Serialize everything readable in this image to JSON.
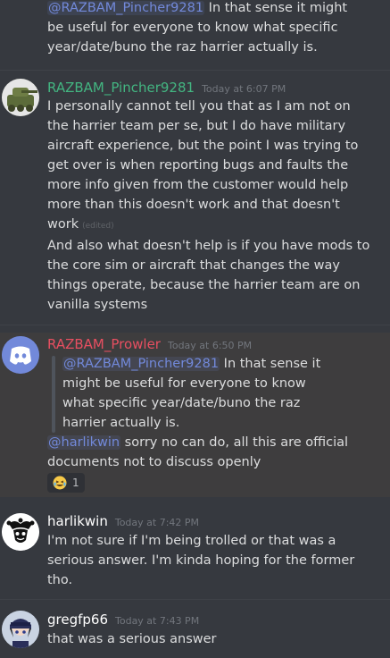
{
  "top_message": {
    "mention": "@RAZBAM_Pincher9281",
    "line1_rest": " In that sense it might",
    "line2": "be useful for everyone to know what specific",
    "line3": "year/date/buno the raz harrier actually is."
  },
  "pincher": {
    "username": "RAZBAM_Pincher9281",
    "timestamp": "Today at 6:07 PM",
    "color": "#43b581",
    "para1_lines": [
      "I personally cannot tell you that as I am not on",
      "the harrier team per se, but I do have military",
      "aircraft experience, but the point I was trying to",
      "get over is when reporting bugs and faults the",
      "more info given from the customer would help",
      "more than this doesn't work and that doesn't",
      "work"
    ],
    "edited": "(edited)",
    "para2_lines": [
      "And also what doesn't help is if you have mods to",
      "the core sim or aircraft that changes the way",
      "things operate, because the harrier team are on",
      "vanilla systems"
    ]
  },
  "prowler": {
    "username": "RAZBAM_Prowler",
    "timestamp": "Today at 6:50 PM",
    "color": "#e84f61",
    "quote_mention": "@RAZBAM_Pincher9281",
    "quote_line1_rest": " In that sense it",
    "quote_lines": [
      "might be useful for everyone to know",
      "what specific year/date/buno the raz",
      "harrier actually is."
    ],
    "reply_mention": "@harlikwin",
    "reply_line1_rest": " sorry no can do, all this are official",
    "reply_line2": "documents not to discuss openly",
    "reaction_count": "1",
    "reaction_icon": "laughing-emoji"
  },
  "harlikwin": {
    "username": "harlikwin",
    "timestamp": "Today at 7:42 PM",
    "lines": [
      "I'm not sure if I'm being trolled or that was a",
      "serious answer. I'm kinda hoping for the former",
      "tho."
    ]
  },
  "gregfp66": {
    "username": "gregfp66",
    "timestamp": "Today at 7:43 PM",
    "lines": [
      "that was a serious answer"
    ]
  }
}
